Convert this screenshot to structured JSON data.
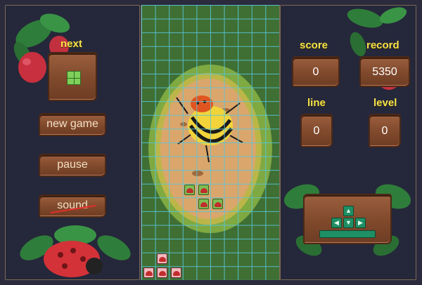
{
  "left": {
    "next_label": "next",
    "new_game_label": "new game",
    "pause_label": "pause",
    "sound_label": "sound"
  },
  "right": {
    "score_label": "score",
    "score_value": "0",
    "record_label": "record",
    "record_value": "5350",
    "line_label": "line",
    "line_value": "0",
    "level_label": "level",
    "level_value": "0"
  },
  "controls": {
    "up": "▲",
    "left": "◀",
    "down": "▼",
    "right": "▶"
  },
  "colors": {
    "board_green": "#3f6f33",
    "grid_line": "#59c6dc",
    "label_yellow": "#f4e04a",
    "wood": "#80492c",
    "control_green": "#1f8f66"
  }
}
